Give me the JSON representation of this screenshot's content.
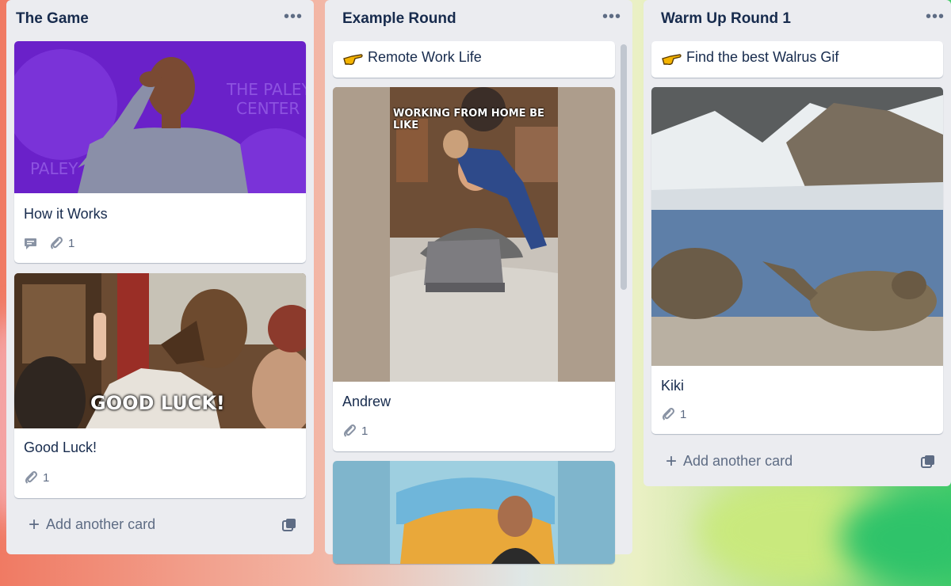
{
  "lists": [
    {
      "title": "The Game",
      "cards": [
        {
          "title": "How it Works",
          "comments_icon": "comment-icon",
          "attachments": "1"
        },
        {
          "title": "Good Luck!",
          "gif_caption": "GOOD LUCK!",
          "attachments": "1"
        }
      ],
      "add_label": "Add another card"
    },
    {
      "title": "Example Round",
      "cards": [
        {
          "title": "Remote Work Life",
          "emoji": "pointing-hand-icon"
        },
        {
          "title": "Andrew",
          "gif_caption": "WORKING FROM HOME BE LIKE",
          "attachments": "1"
        }
      ]
    },
    {
      "title": "Warm Up Round 1",
      "cards": [
        {
          "title": "Find the best Walrus Gif",
          "emoji": "pointing-hand-icon"
        },
        {
          "title": "Kiki",
          "attachments": "1"
        }
      ],
      "add_label": "Add another card"
    }
  ],
  "colors": {
    "list_bg": "#ebecf0",
    "text": "#172b4d",
    "muted": "#5e6c84"
  }
}
